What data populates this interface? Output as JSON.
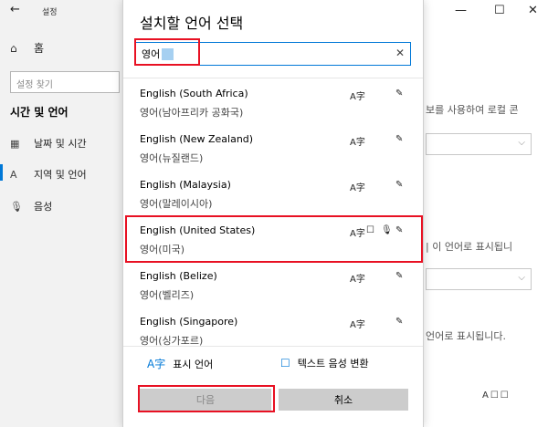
{
  "background": {
    "app_title": "설정",
    "back_glyph": "←",
    "home_label": "홈",
    "search_placeholder": "설정 찾기",
    "section_title": "시간 및 언어",
    "nav": [
      {
        "label": "날짜 및 시간",
        "icon": "calendar-icon"
      },
      {
        "label": "지역 및 언어",
        "icon": "region-icon"
      },
      {
        "label": "음성",
        "icon": "microphone-icon"
      }
    ],
    "window_controls": {
      "minimize": "—",
      "maximize": "☐",
      "close": "✕"
    },
    "snippets": {
      "line1": "보를 사용하여 로컬 콘",
      "line2": "| 이 언어로 표시됩니",
      "line3": "언어로 표시됩니다."
    },
    "chevron": "⌵",
    "bottom_icons": "A☐☐"
  },
  "dialog": {
    "title": "설치할 언어 선택",
    "search_value": "영어",
    "clear_glyph": "✕",
    "languages": [
      {
        "name": "English (South Africa)",
        "native": "영어(남아프리카 공화국)",
        "features": [
          "A字",
          "✎"
        ]
      },
      {
        "name": "English (New Zealand)",
        "native": "영어(뉴질랜드)",
        "features": [
          "A字",
          "✎"
        ]
      },
      {
        "name": "English (Malaysia)",
        "native": "영어(말레이시아)",
        "features": [
          "A字",
          "✎"
        ]
      },
      {
        "name": "English (United States)",
        "native": "영어(미국)",
        "features": [
          "A字",
          "☐",
          "🎙",
          "✎"
        ]
      },
      {
        "name": "English (Belize)",
        "native": "영어(벨리즈)",
        "features": [
          "A字",
          "✎"
        ]
      },
      {
        "name": "English (Singapore)",
        "native": "영어(싱가포르)",
        "features": [
          "A字",
          "✎"
        ]
      }
    ],
    "legend": {
      "display_language": "표시 언어",
      "text_to_speech": "텍스트 음성 변환"
    },
    "buttons": {
      "next": "다음",
      "cancel": "취소"
    }
  },
  "colors": {
    "accent": "#0078d7",
    "highlight_box": "#e81123",
    "button_bg": "#cccccc"
  }
}
